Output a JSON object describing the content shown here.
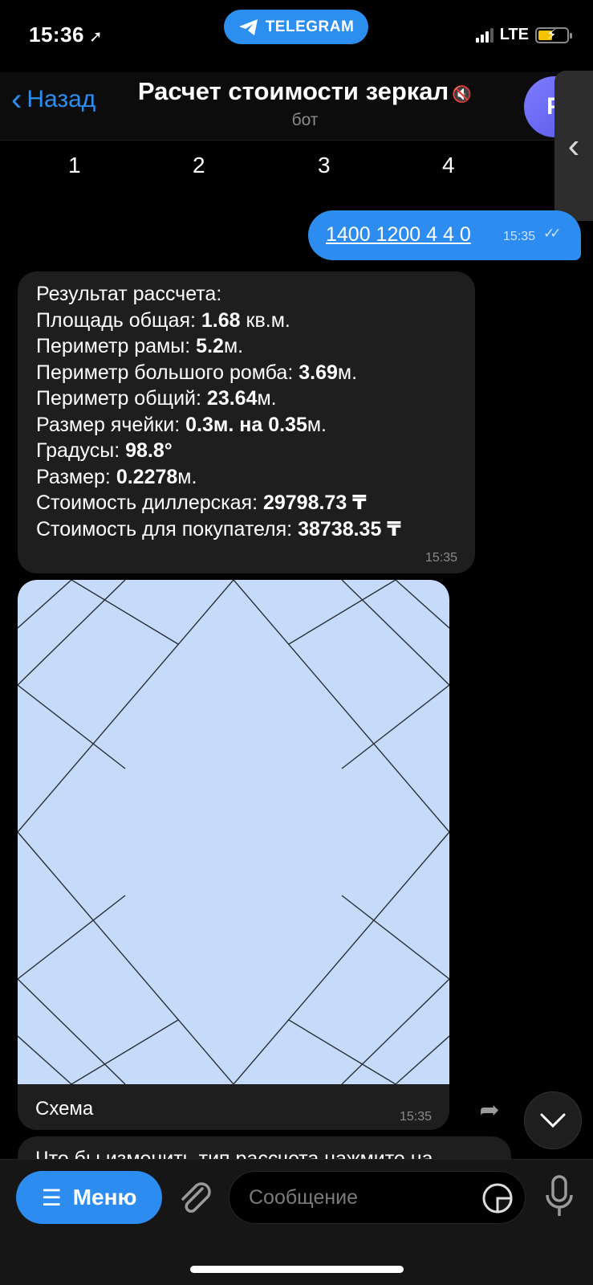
{
  "status": {
    "time": "15:36",
    "network": "LTE",
    "pill_label": "TELEGRAM"
  },
  "header": {
    "back_label": "Назад",
    "title": "Расчет стоимости зеркал",
    "subtitle": "бот",
    "avatar_letter": "Р"
  },
  "keyboard_numbers": [
    "1",
    "2",
    "3",
    "4"
  ],
  "messages": {
    "outgoing": {
      "text": "1400 1200 4 4 0",
      "time": "15:35"
    },
    "result": {
      "time": "15:35",
      "lines": [
        {
          "label": "Результат рассчета:",
          "value": "",
          "unit": ""
        },
        {
          "label": "Площадь общая: ",
          "value": "1.68",
          "unit": " кв.м."
        },
        {
          "label": "Периметр рамы: ",
          "value": "5.2",
          "unit": "м."
        },
        {
          "label": "Периметр большого ромба: ",
          "value": "3.69",
          "unit": "м."
        },
        {
          "label": "Периметр общий: ",
          "value": "23.64",
          "unit": "м."
        },
        {
          "label": "Размер ячейки: ",
          "value": "0.3м. на 0.35",
          "unit": "м."
        },
        {
          "label": "Градусы: ",
          "value": "98.8°",
          "unit": ""
        },
        {
          "label": "Размер: ",
          "value": "0.2278",
          "unit": "м."
        },
        {
          "label": "Стоимость диллерская: ",
          "value": "29798.73 ₸",
          "unit": ""
        },
        {
          "label": "Стоимость для покупателя: ",
          "value": "38738.35 ₸",
          "unit": ""
        }
      ]
    },
    "image": {
      "caption": "Схема",
      "time": "15:35"
    },
    "partial_text": "Что бы изменить тип рассчета нажмите на"
  },
  "input": {
    "menu_label": "Меню",
    "placeholder": "Сообщение"
  },
  "colors": {
    "accent": "#2d8cf0",
    "bubble_in": "#1e1e1e",
    "scheme_bg": "#c6dbfa"
  }
}
